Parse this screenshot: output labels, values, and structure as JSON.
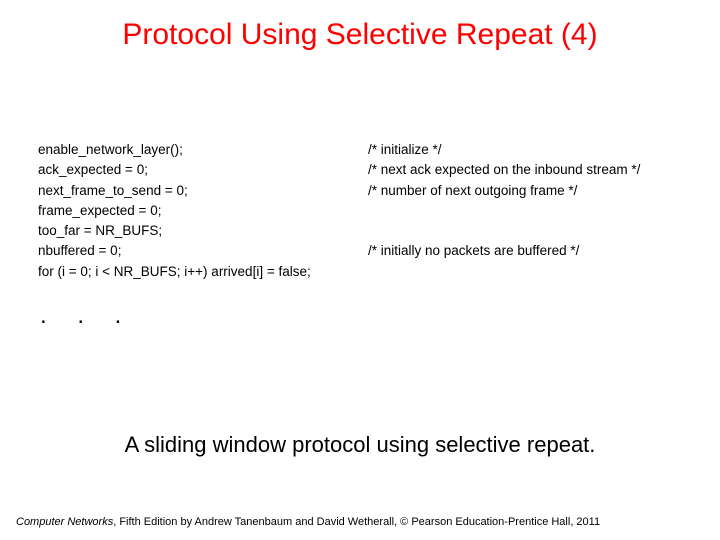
{
  "title": "Protocol Using Selective Repeat (4)",
  "code": {
    "lines": [
      {
        "stmt": "enable_network_layer();",
        "cmt": "/* initialize */"
      },
      {
        "stmt": "ack_expected = 0;",
        "cmt": "/* next ack expected on the inbound stream */"
      },
      {
        "stmt": "next_frame_to_send = 0;",
        "cmt": "/* number of next outgoing frame */"
      },
      {
        "stmt": "frame_expected = 0;",
        "cmt": ""
      },
      {
        "stmt": "too_far = NR_BUFS;",
        "cmt": ""
      },
      {
        "stmt": "nbuffered = 0;",
        "cmt": "/* initially no packets are buffered */"
      },
      {
        "stmt": "for (i = 0; i < NR_BUFS; i++) arrived[i] = false;",
        "cmt": ""
      }
    ],
    "ellipsis": ". . ."
  },
  "caption": "A sliding window protocol using selective repeat.",
  "footer": {
    "book": "Computer Networks",
    "rest": ", Fifth Edition by Andrew Tanenbaum and David Wetherall, © Pearson Education-Prentice Hall, 2011"
  }
}
